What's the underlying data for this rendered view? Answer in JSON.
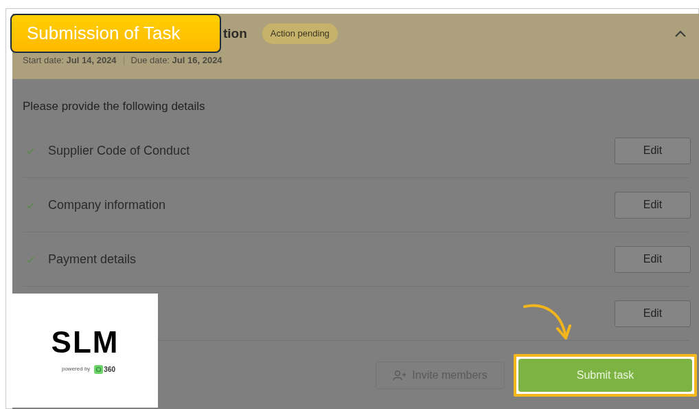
{
  "callout": {
    "text": "Submission of Task"
  },
  "task": {
    "title": "tion",
    "status": "Action pending",
    "start_date": "Start date: **Jul 14, 2024**",
    "due_date": "Due date: **Jul 16, 2024**",
    "expanded": true
  },
  "prompt": "Please provide the following details",
  "sections": [
    {
      "label": "Supplier Code of Conduct",
      "done": true,
      "action": "Edit"
    },
    {
      "label": "Company information",
      "done": true,
      "action": "Edit"
    },
    {
      "label": "Payment details",
      "done": true,
      "action": "Edit"
    },
    {
      "action": "Edit"
    }
  ],
  "footer": {
    "invite": "Invite members",
    "submit": "Submit task",
    "submit_highlighted": true
  },
  "logo": {
    "wordmark": "SLM",
    "tagline": "powered by",
    "partner": "360"
  }
}
